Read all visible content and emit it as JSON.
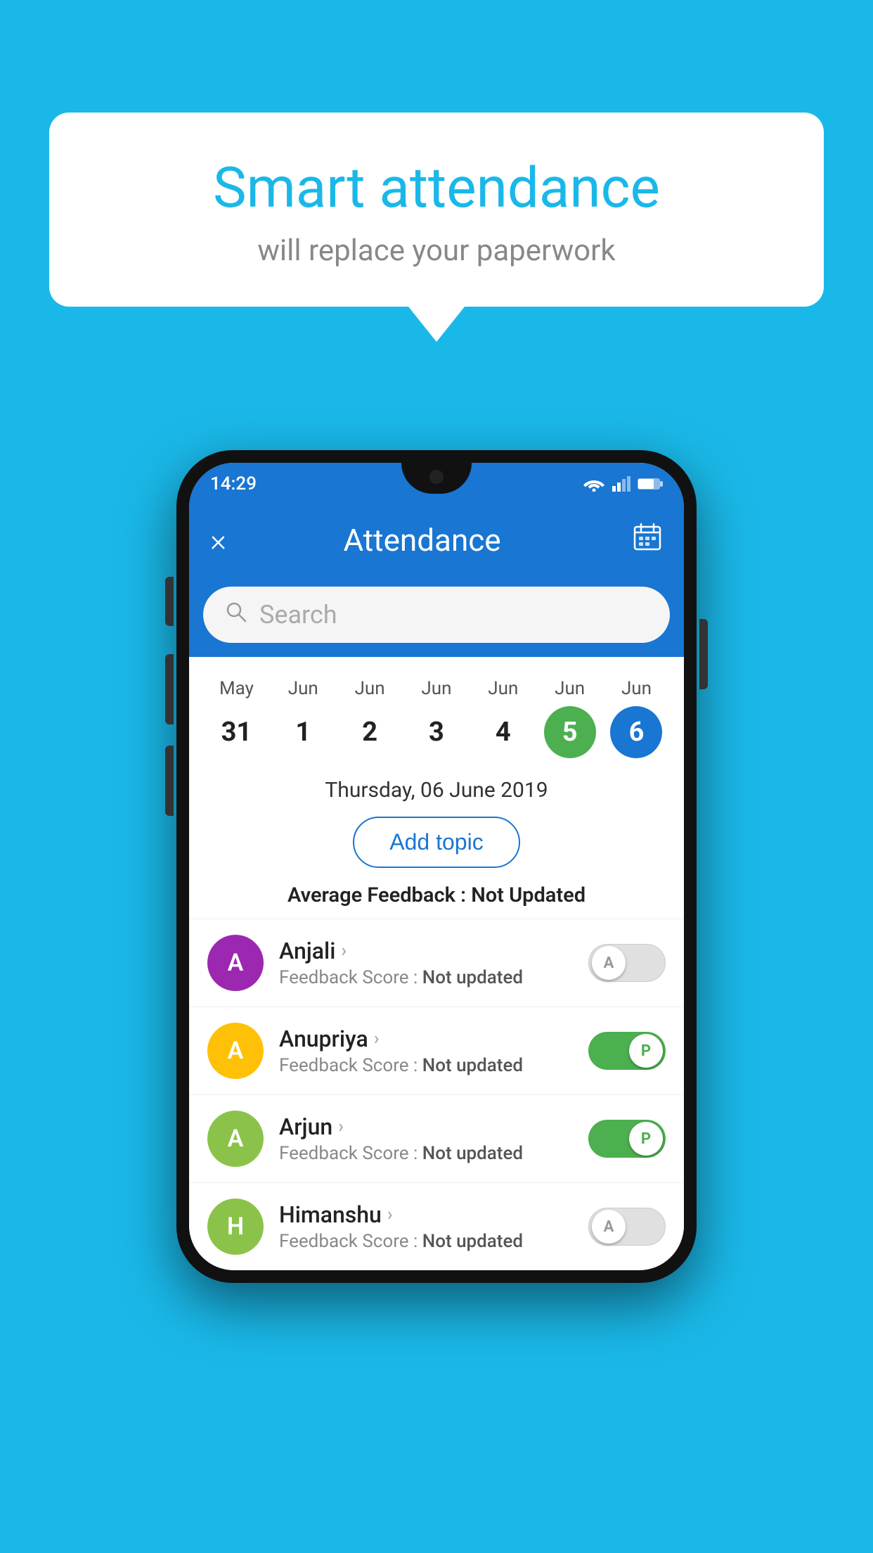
{
  "background_color": "#1ab8e8",
  "speech_bubble": {
    "title": "Smart attendance",
    "subtitle": "will replace your paperwork"
  },
  "status_bar": {
    "time": "14:29"
  },
  "app_bar": {
    "title": "Attendance",
    "close_label": "×",
    "calendar_icon": "📅"
  },
  "search": {
    "placeholder": "Search"
  },
  "calendar": {
    "days": [
      {
        "month": "May",
        "date": "31",
        "state": "normal"
      },
      {
        "month": "Jun",
        "date": "1",
        "state": "normal"
      },
      {
        "month": "Jun",
        "date": "2",
        "state": "normal"
      },
      {
        "month": "Jun",
        "date": "3",
        "state": "normal"
      },
      {
        "month": "Jun",
        "date": "4",
        "state": "normal"
      },
      {
        "month": "Jun",
        "date": "5",
        "state": "today"
      },
      {
        "month": "Jun",
        "date": "6",
        "state": "selected"
      }
    ]
  },
  "selected_date": "Thursday, 06 June 2019",
  "add_topic_label": "Add topic",
  "avg_feedback": {
    "label": "Average Feedback : ",
    "value": "Not Updated"
  },
  "students": [
    {
      "name": "Anjali",
      "avatar_letter": "A",
      "avatar_color": "#9c27b0",
      "feedback": "Feedback Score : Not updated",
      "toggle_state": "off",
      "toggle_label": "A"
    },
    {
      "name": "Anupriya",
      "avatar_letter": "A",
      "avatar_color": "#ffc107",
      "feedback": "Feedback Score : Not updated",
      "toggle_state": "on",
      "toggle_label": "P"
    },
    {
      "name": "Arjun",
      "avatar_letter": "A",
      "avatar_color": "#8bc34a",
      "feedback": "Feedback Score : Not updated",
      "toggle_state": "on",
      "toggle_label": "P"
    },
    {
      "name": "Himanshu",
      "avatar_letter": "H",
      "avatar_color": "#8bc34a",
      "feedback": "Feedback Score : Not updated",
      "toggle_state": "off",
      "toggle_label": "A"
    }
  ]
}
